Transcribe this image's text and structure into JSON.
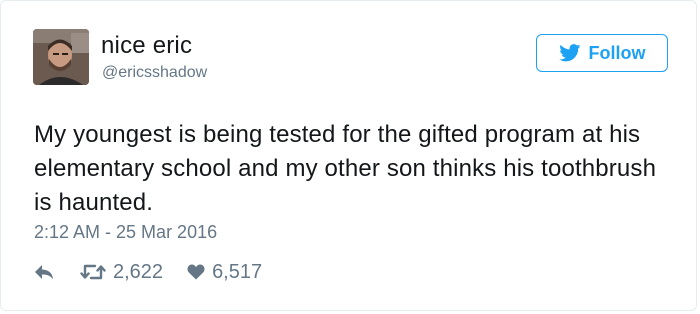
{
  "user": {
    "display_name": "nice eric",
    "handle": "@ericsshadow",
    "avatar_icon": "profile-photo"
  },
  "follow_button": {
    "label": "Follow",
    "icon": "twitter-bird-icon",
    "color": "#1da1f2"
  },
  "tweet": {
    "text": "My youngest is being tested for the gifted program at his elementary school and my other son thinks his toothbrush is haunted.",
    "timestamp": "2:12 AM - 25 Mar 2016"
  },
  "actions": {
    "reply_icon": "reply-icon",
    "retweet_icon": "retweet-icon",
    "retweet_count": "2,622",
    "like_icon": "heart-icon",
    "like_count": "6,517"
  },
  "colors": {
    "text": "#14171a",
    "secondary": "#657786",
    "border": "#e6ecf0"
  }
}
